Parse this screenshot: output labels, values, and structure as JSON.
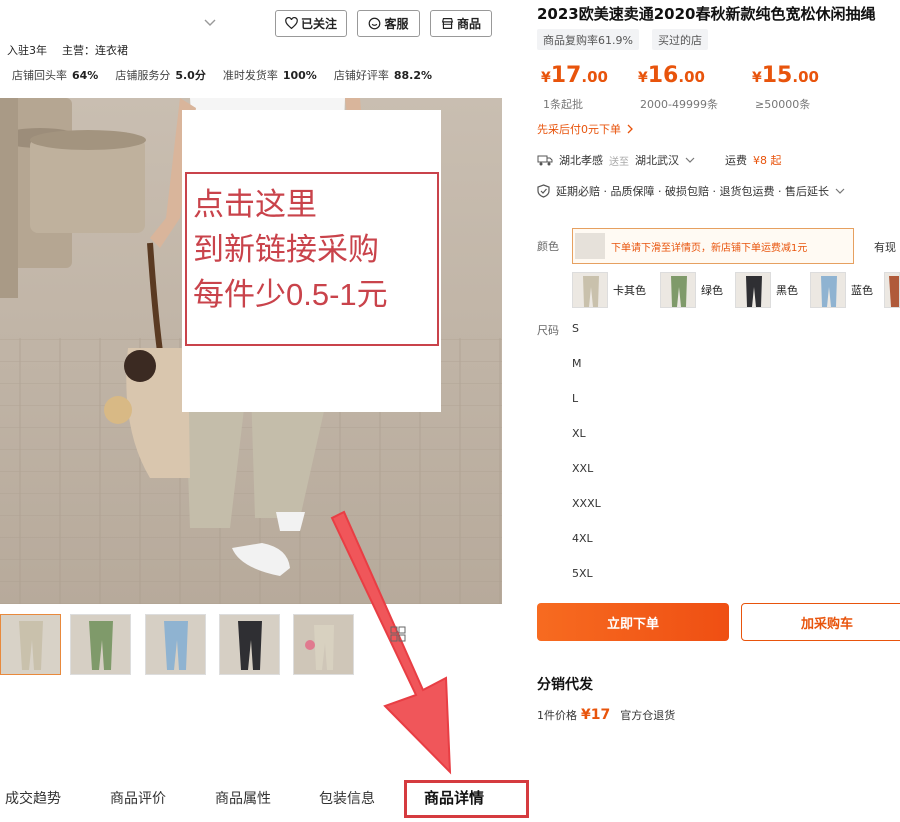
{
  "shop": {
    "follow_label": "已关注",
    "service_label": "客服",
    "goods_label": "商品",
    "years": "入驻3年",
    "main_business": "主营：连衣裙",
    "stats": [
      {
        "label": "店铺回头率",
        "value": "64%"
      },
      {
        "label": "店铺服务分",
        "value": "5.0分"
      },
      {
        "label": "准时发货率",
        "value": "100%"
      },
      {
        "label": "店铺好评率",
        "value": "88.2%"
      }
    ]
  },
  "overlay": {
    "lines": [
      "点击这里",
      "到新链接采购",
      "每件少0.5-1元"
    ],
    "accent_color": "#c9434b"
  },
  "thumbnails": [
    "khaki-pants",
    "green-pants",
    "blue-pants",
    "black-pants",
    "model-pants"
  ],
  "tabs": [
    "成交趋势",
    "商品评价",
    "商品属性",
    "包装信息",
    "商品详情"
  ],
  "active_tab": "商品详情",
  "product": {
    "title": "2023欧美速卖通2020春秋新款纯色宽松休闲抽绳",
    "tags": [
      "商品复购率61.9%",
      "买过的店"
    ],
    "prices": [
      {
        "currency": "¥",
        "int": "17",
        "dec": ".00",
        "condition": "1条起批"
      },
      {
        "currency": "¥",
        "int": "16",
        "dec": ".00",
        "condition": "2000-49999条"
      },
      {
        "currency": "¥",
        "int": "15",
        "dec": ".00",
        "condition": "≥50000条"
      }
    ],
    "pay_later": "先采后付0元下单",
    "ship_from": "湖北孝感",
    "ship_word": "送至",
    "ship_to": "湖北武汉",
    "freight_label": "运费",
    "freight_value": "¥8 起",
    "services": "延期必赔 · 品质保障 · 破损包赔 · 退货包运费 · 售后延长",
    "color_label": "颜色",
    "banner_text": "下单请下滑至详情页，新店铺下单运费减1元",
    "more_text": "有现",
    "colors": [
      "卡其色",
      "绿色",
      "黑色",
      "蓝色"
    ],
    "size_label": "尺码",
    "sizes": [
      "S",
      "M",
      "L",
      "XL",
      "XXL",
      "XXXL",
      "4XL",
      "5XL"
    ],
    "buy_now": "立即下单",
    "add_cart": "加采购车",
    "dist_title": "分销代发",
    "dist_price_label": "1件价格",
    "dist_price": "¥17",
    "dist_note": "官方仓退货",
    "brand_color": "#e8540c"
  }
}
